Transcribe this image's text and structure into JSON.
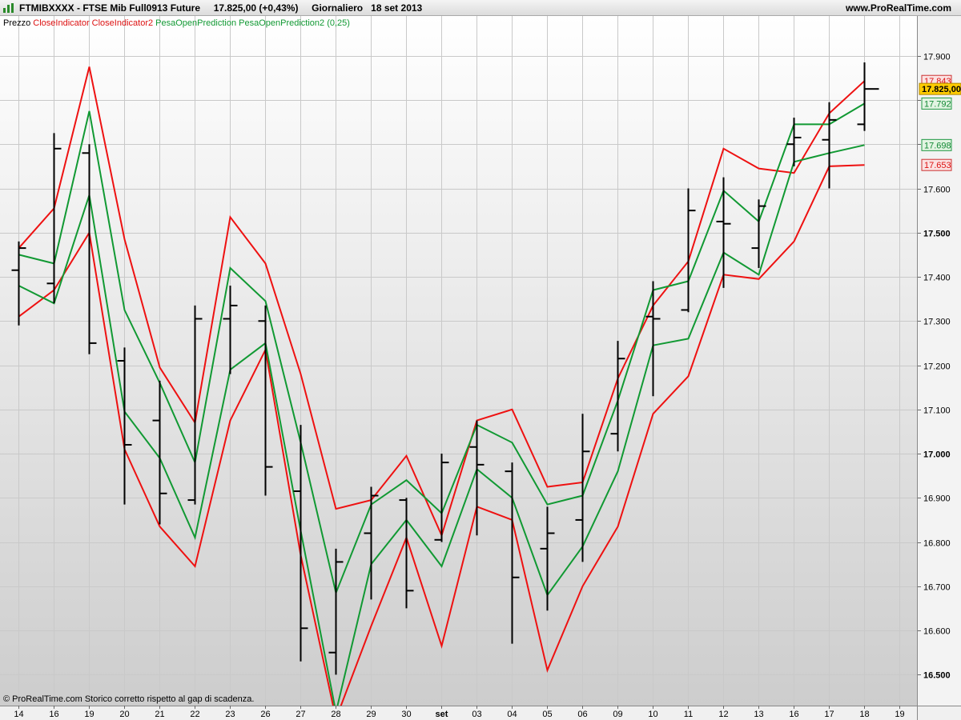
{
  "header": {
    "title": "FTMIBXXXX - FTSE Mib Full0913 Future",
    "price": "17.825,00 (+0,43%)",
    "timeframe": "Giornaliero",
    "date": "18 set 2013",
    "site": "www.ProRealTime.com",
    "logo_icon": "bar-chart-icon"
  },
  "legend": [
    {
      "text": "Prezzo",
      "color": "#000000"
    },
    {
      "text": "CloseIndicator",
      "color": "#dd1111"
    },
    {
      "text": "CloseIndicator2",
      "color": "#dd1111"
    },
    {
      "text": "PesaOpenPrediction",
      "color": "#119933"
    },
    {
      "text": "PesaOpenPrediction2",
      "color": "#119933"
    },
    {
      "text": "(0,25)",
      "color": "#119933"
    }
  ],
  "footer_note": "© ProRealTime.com Storico corretto rispetto al gap di scadenza.",
  "colors": {
    "red": "#ee1111",
    "green": "#119933",
    "price_tag_bg": "#ffcc00",
    "red_tag_bg": "#fbe2e2",
    "green_tag_bg": "#e2f4e2"
  },
  "chart_data": {
    "type": "line",
    "ylim": [
      16430,
      17990
    ],
    "grid": true,
    "x": [
      "14",
      "16",
      "19",
      "20",
      "21",
      "22",
      "23",
      "26",
      "27",
      "28",
      "29",
      "30",
      "set",
      "03",
      "04",
      "05",
      "06",
      "09",
      "10",
      "11",
      "12",
      "13",
      "16",
      "17",
      "18",
      "19"
    ],
    "ohlc": [
      {
        "o": 17415,
        "h": 17480,
        "l": 17290,
        "c": 17465
      },
      {
        "o": 17385,
        "h": 17725,
        "l": 17340,
        "c": 17690
      },
      {
        "o": 17680,
        "h": 17700,
        "l": 17225,
        "c": 17250
      },
      {
        "o": 17210,
        "h": 17240,
        "l": 16885,
        "c": 17020
      },
      {
        "o": 17075,
        "h": 17165,
        "l": 16840,
        "c": 16910
      },
      {
        "o": 16895,
        "h": 17335,
        "l": 16885,
        "c": 17305
      },
      {
        "o": 17305,
        "h": 17380,
        "l": 17180,
        "c": 17335
      },
      {
        "o": 17300,
        "h": 17335,
        "l": 16905,
        "c": 16970
      },
      {
        "o": 16915,
        "h": 17065,
        "l": 16530,
        "c": 16605
      },
      {
        "o": 16550,
        "h": 16785,
        "l": 16500,
        "c": 16755
      },
      {
        "o": 16820,
        "h": 16925,
        "l": 16670,
        "c": 16905
      },
      {
        "o": 16895,
        "h": 16900,
        "l": 16650,
        "c": 16690
      },
      {
        "o": 16805,
        "h": 17000,
        "l": 16800,
        "c": 16980
      },
      {
        "o": 17015,
        "h": 17075,
        "l": 16815,
        "c": 16975
      },
      {
        "o": 16960,
        "h": 16980,
        "l": 16570,
        "c": 16720
      },
      {
        "o": 16785,
        "h": 16880,
        "l": 16645,
        "c": 16820
      },
      {
        "o": 16850,
        "h": 17090,
        "l": 16755,
        "c": 17005
      },
      {
        "o": 17045,
        "h": 17255,
        "l": 17005,
        "c": 17215
      },
      {
        "o": 17310,
        "h": 17390,
        "l": 17130,
        "c": 17305
      },
      {
        "o": 17325,
        "h": 17600,
        "l": 17320,
        "c": 17550
      },
      {
        "o": 17525,
        "h": 17625,
        "l": 17375,
        "c": 17520
      },
      {
        "o": 17465,
        "h": 17575,
        "l": 17420,
        "c": 17560
      },
      {
        "o": 17700,
        "h": 17760,
        "l": 17650,
        "c": 17715
      },
      {
        "o": 17710,
        "h": 17795,
        "l": 17600,
        "c": 17755
      },
      {
        "o": 17745,
        "h": 17885,
        "l": 17730,
        "c": 17825
      }
    ],
    "series": [
      {
        "name": "CloseIndicator",
        "color": "#ee1111",
        "values": [
          17465,
          17555,
          17875,
          17485,
          17195,
          17070,
          17535,
          17430,
          17180,
          16875,
          16895,
          16995,
          16815,
          17075,
          17100,
          16925,
          16935,
          17170,
          17335,
          17435,
          17690,
          17645,
          17635,
          17770,
          17843
        ]
      },
      {
        "name": "CloseIndicator2",
        "color": "#ee1111",
        "values": [
          17310,
          17370,
          17500,
          17010,
          16835,
          16745,
          17075,
          17235,
          16770,
          16400,
          16610,
          16810,
          16565,
          16880,
          16850,
          16510,
          16700,
          16835,
          17090,
          17175,
          17405,
          17395,
          17480,
          17650,
          17653
        ]
      },
      {
        "name": "PesaOpenPrediction",
        "color": "#119933",
        "values": [
          17450,
          17430,
          17775,
          17325,
          17160,
          16980,
          17420,
          17345,
          17025,
          16685,
          16885,
          16940,
          16865,
          17065,
          17025,
          16885,
          16905,
          17120,
          17370,
          17390,
          17595,
          17525,
          17745,
          17745,
          17792
        ]
      },
      {
        "name": "PesaOpenPrediction2",
        "color": "#119933",
        "values": [
          17380,
          17340,
          17585,
          17095,
          16990,
          16810,
          17190,
          17250,
          16825,
          16415,
          16750,
          16850,
          16745,
          16965,
          16900,
          16680,
          16790,
          16960,
          17245,
          17260,
          17455,
          17405,
          17660,
          17680,
          17698
        ]
      }
    ],
    "y_ticks": [
      "17.900",
      "17.800",
      "17.700",
      "17.600",
      "17.500",
      "17.400",
      "17.300",
      "17.200",
      "17.100",
      "17.000",
      "16.900",
      "16.800",
      "16.700",
      "16.600",
      "16.500"
    ],
    "y_tick_values": [
      17900,
      17800,
      17700,
      17600,
      17500,
      17400,
      17300,
      17200,
      17100,
      17000,
      16900,
      16800,
      16700,
      16600,
      16500
    ],
    "bold_ticks": [
      17500,
      17000,
      16500
    ],
    "price_tags": [
      {
        "label": "17.843",
        "value": 17843,
        "kind": "red"
      },
      {
        "label": "17.825,00",
        "value": 17825,
        "kind": "price"
      },
      {
        "label": "17.792",
        "value": 17792,
        "kind": "green"
      },
      {
        "label": "17.698",
        "value": 17698,
        "kind": "green"
      },
      {
        "label": "17.653",
        "value": 17653,
        "kind": "red"
      }
    ]
  }
}
